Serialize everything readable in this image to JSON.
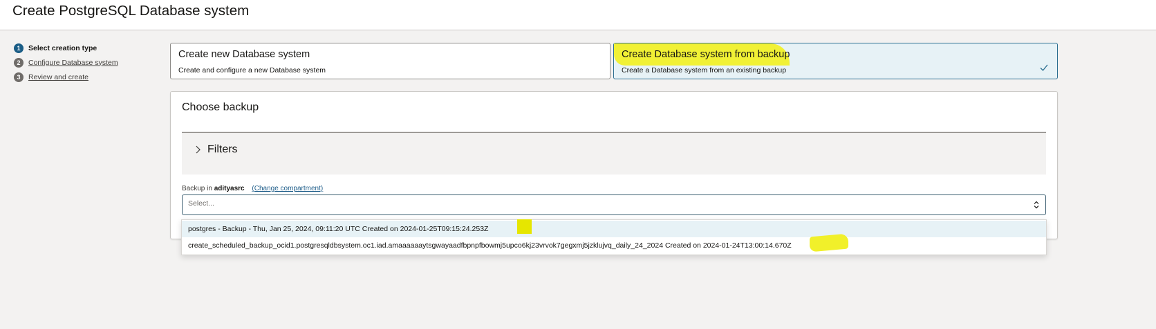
{
  "header": {
    "title": "Create PostgreSQL Database system"
  },
  "steps": [
    {
      "num": "1",
      "label": "Select creation type"
    },
    {
      "num": "2",
      "label": "Configure Database system"
    },
    {
      "num": "3",
      "label": "Review and create"
    }
  ],
  "cards": {
    "new": {
      "title": "Create new Database system",
      "desc": "Create and configure a new Database system"
    },
    "backup": {
      "title": "Create Database system from backup",
      "desc": "Create a Database system from an existing backup",
      "icon": "check-icon"
    }
  },
  "choose_backup": {
    "title": "Choose backup",
    "filters_label": "Filters",
    "label_prefix": "Backup in",
    "compartment": "adityasrc",
    "change_link": "(Change compartment)",
    "placeholder": "Select...",
    "options": [
      "postgres - Backup - Thu, Jan 25, 2024, 09:11:20 UTC Created on 2024-01-25T09:15:24.253Z",
      "create_scheduled_backup_ocid1.postgresqldbsystem.oc1.iad.amaaaaaaytsgwayaadfbpnpfbowmj5upco6kj23vrvok7gegxmj5jzklujvq_daily_24_2024 Created on 2024-01-24T13:00:14.670Z"
    ]
  },
  "colors": {
    "accent": "#1a5d86",
    "highlight": "#f1f02a",
    "selected_bg": "#e7f2f6"
  }
}
